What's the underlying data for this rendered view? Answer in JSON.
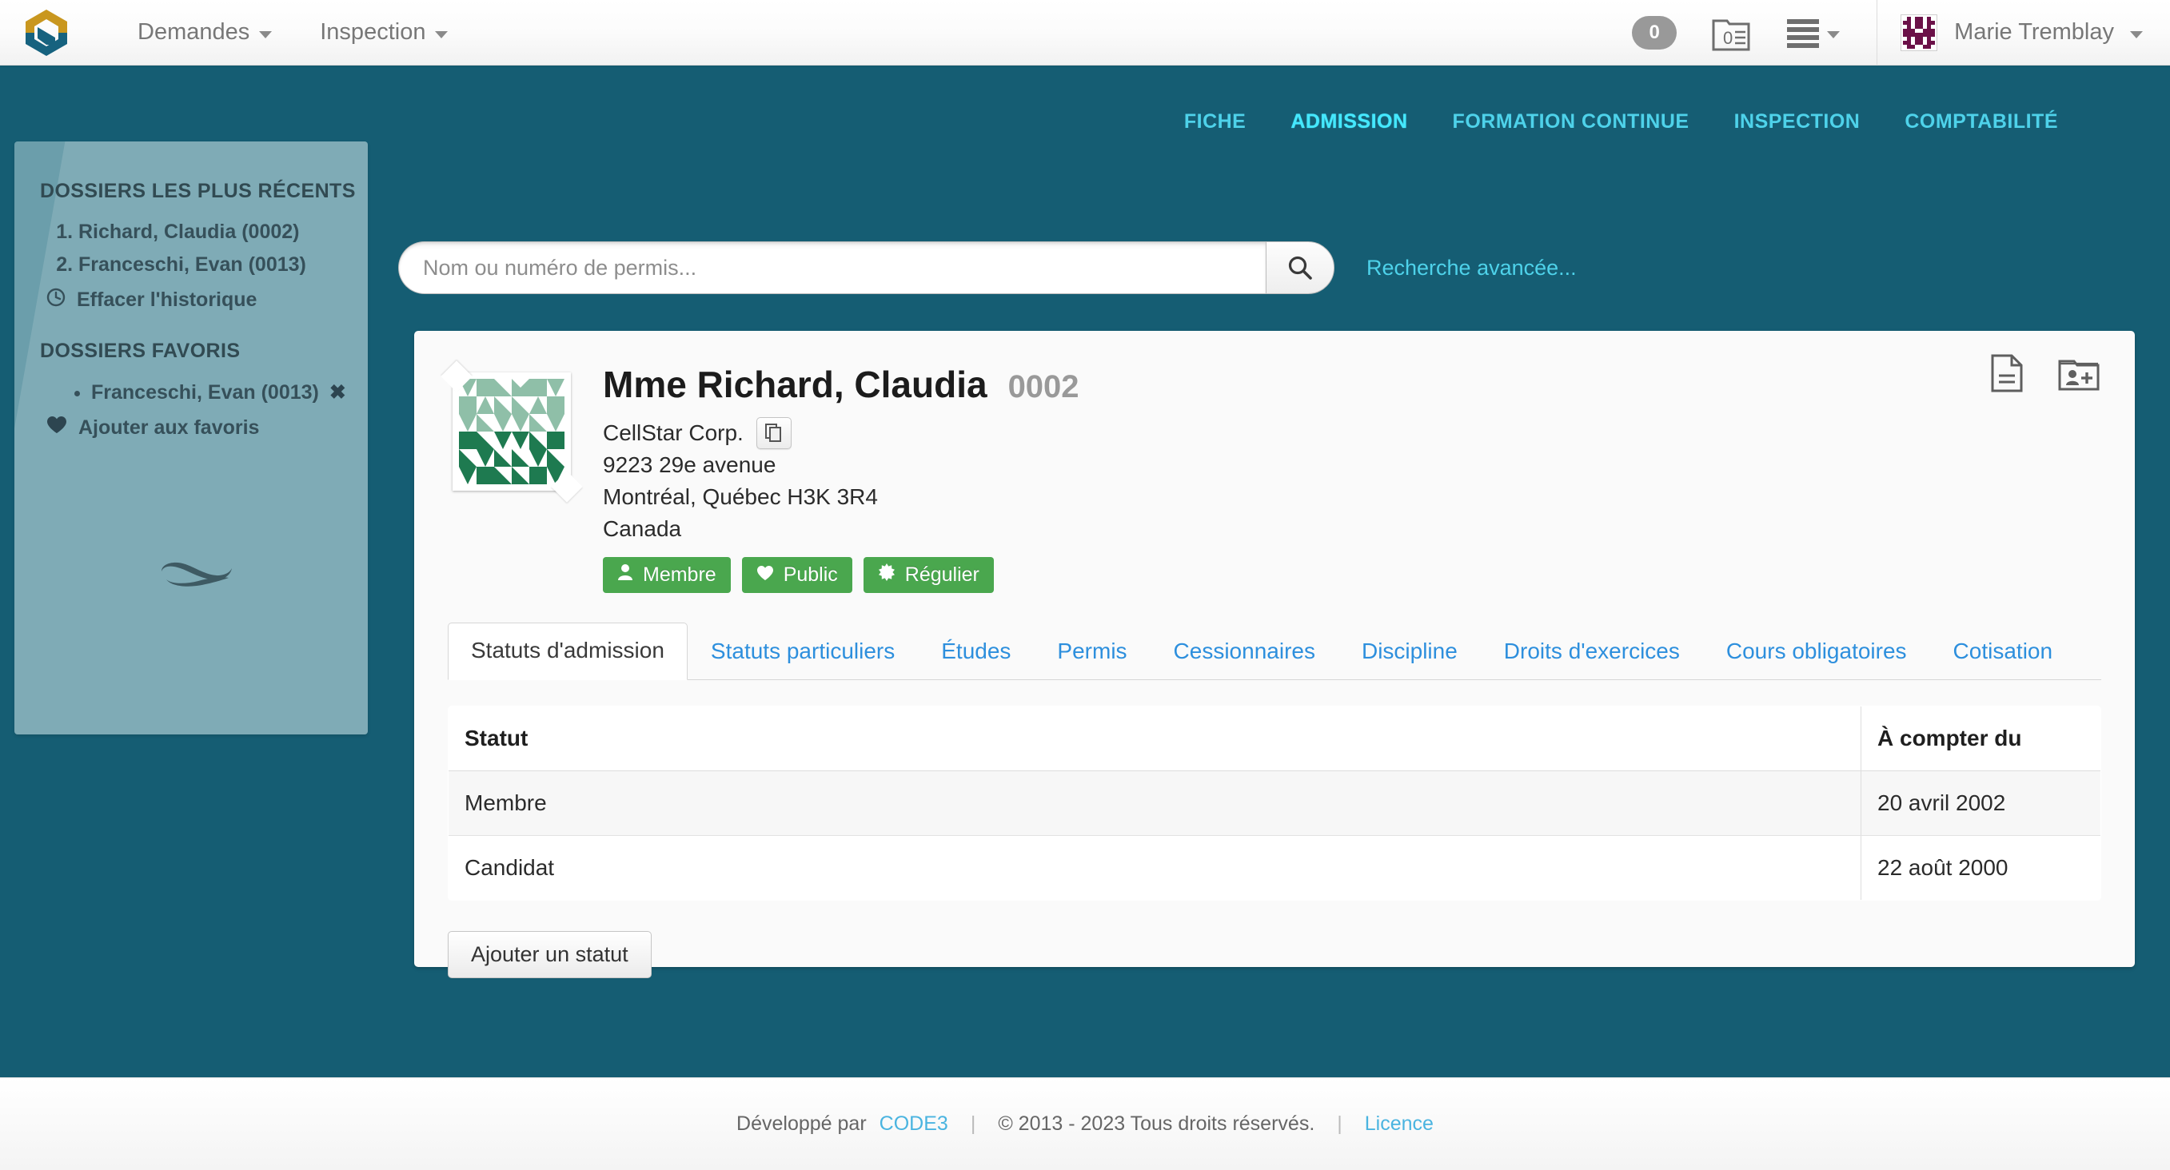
{
  "colors": {
    "teal_bg": "#155d73",
    "sidebar": "#6b9eab",
    "accent_cyan": "#4ed2ea",
    "active_cyan": "#45e8ff",
    "badge_green": "#4aa74e",
    "link_blue": "#2d8fdd",
    "logo_gold": "#c9971f",
    "logo_teal": "#16627f"
  },
  "navbar": {
    "logo_name": "app-logo",
    "links": [
      {
        "label": "Demandes",
        "has_caret": true
      },
      {
        "label": "Inspection",
        "has_caret": true
      }
    ],
    "notification_count": "0",
    "folder_icon_count": "0",
    "icons": {
      "folder": "folder-zero-icon",
      "list": "list-menu-icon"
    },
    "user": {
      "name": "Marie Tremblay",
      "avatar": "user-avatar-identicon"
    }
  },
  "top_tabs": [
    {
      "label": "FICHE",
      "active": false
    },
    {
      "label": "ADMISSION",
      "active": true
    },
    {
      "label": "FORMATION CONTINUE",
      "active": false
    },
    {
      "label": "INSPECTION",
      "active": false
    },
    {
      "label": "COMPTABILITÉ",
      "active": false
    }
  ],
  "sidebar": {
    "recent_title": "DOSSIERS LES PLUS RÉCENTS",
    "recent_items": [
      "Richard, Claudia (0002)",
      "Franceschi, Evan (0013)"
    ],
    "clear_history": "Effacer l'historique",
    "favorites_title": "DOSSIERS FAVORIS",
    "favorite_items": [
      {
        "label": "Franceschi, Evan (0013)",
        "remove": "✖"
      }
    ],
    "add_favorite": "Ajouter aux favoris"
  },
  "search": {
    "placeholder": "Nom ou numéro de permis...",
    "value": "",
    "button_icon": "search-icon",
    "advanced_link": "Recherche avancée..."
  },
  "person": {
    "name": "Mme Richard, Claudia",
    "number": "0002",
    "company": "CellStar Corp.",
    "address_line1": "9223 29e avenue",
    "address_line2": "Montréal, Québec H3K 3R4",
    "country": "Canada",
    "badges": [
      {
        "label": "Membre",
        "icon": "person-icon"
      },
      {
        "label": "Public",
        "icon": "heart-icon"
      },
      {
        "label": "Régulier",
        "icon": "burst-icon"
      }
    ],
    "card_actions": [
      {
        "icon": "document-icon"
      },
      {
        "icon": "folder-add-person-icon"
      }
    ]
  },
  "tabs": [
    {
      "label": "Statuts d'admission",
      "active": true
    },
    {
      "label": "Statuts particuliers",
      "active": false
    },
    {
      "label": "Études",
      "active": false
    },
    {
      "label": "Permis",
      "active": false
    },
    {
      "label": "Cessionnaires",
      "active": false
    },
    {
      "label": "Discipline",
      "active": false
    },
    {
      "label": "Droits d'exercices",
      "active": false
    },
    {
      "label": "Cours obligatoires",
      "active": false
    },
    {
      "label": "Cotisation",
      "active": false
    }
  ],
  "table": {
    "headers": [
      "Statut",
      "À compter du"
    ],
    "rows": [
      {
        "statut": "Membre",
        "date": "20 avril 2002"
      },
      {
        "statut": "Candidat",
        "date": "22 août 2000"
      }
    ]
  },
  "add_status_button": "Ajouter un statut",
  "footer": {
    "dev_by": "Développé par",
    "dev_name": "CODE3",
    "copyright": "© 2013 - 2023 Tous droits réservés.",
    "licence": "Licence"
  }
}
